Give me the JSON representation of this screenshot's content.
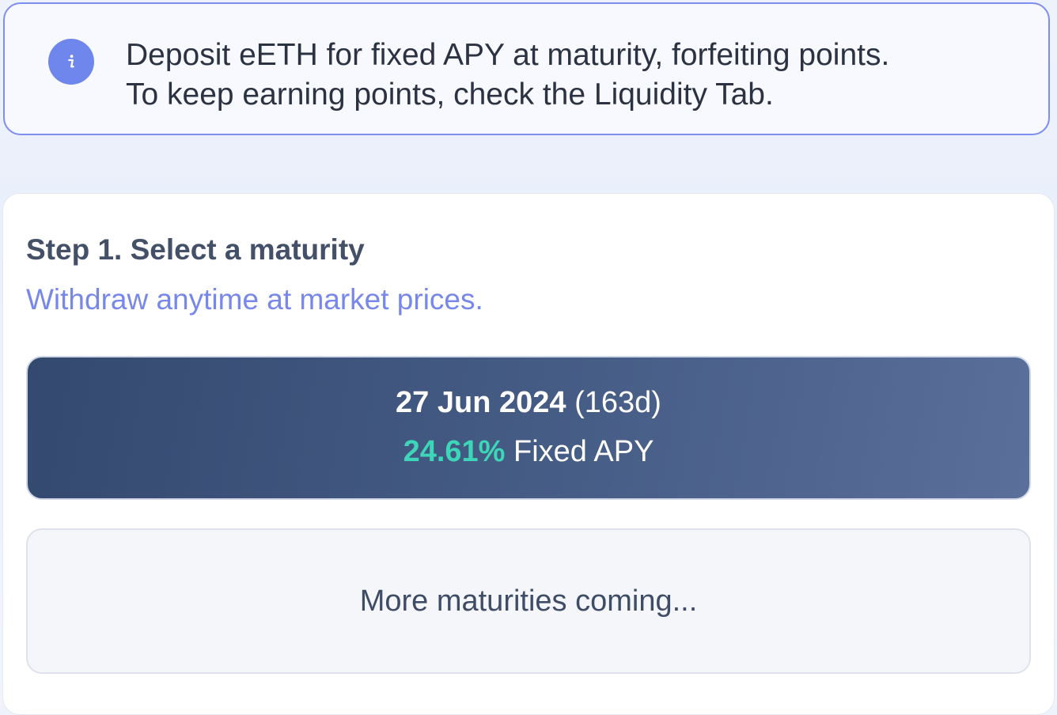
{
  "banner": {
    "icon": "info-icon",
    "icon_color": "#6f86ec",
    "border_color": "#7d8ef0",
    "line1": "Deposit eETH for fixed APY at maturity, forfeiting points.",
    "line2": "To keep earning points, check the Liquidity Tab."
  },
  "step": {
    "title": "Step 1. Select a maturity",
    "subtitle": "Withdraw anytime at market prices."
  },
  "maturities": [
    {
      "date": "27 Jun 2024",
      "days": "(163d)",
      "apy": "24.61%",
      "apy_label": "Fixed APY",
      "apy_color": "#3dd6b8",
      "selected": true
    }
  ],
  "more_maturities": "More maturities coming..."
}
